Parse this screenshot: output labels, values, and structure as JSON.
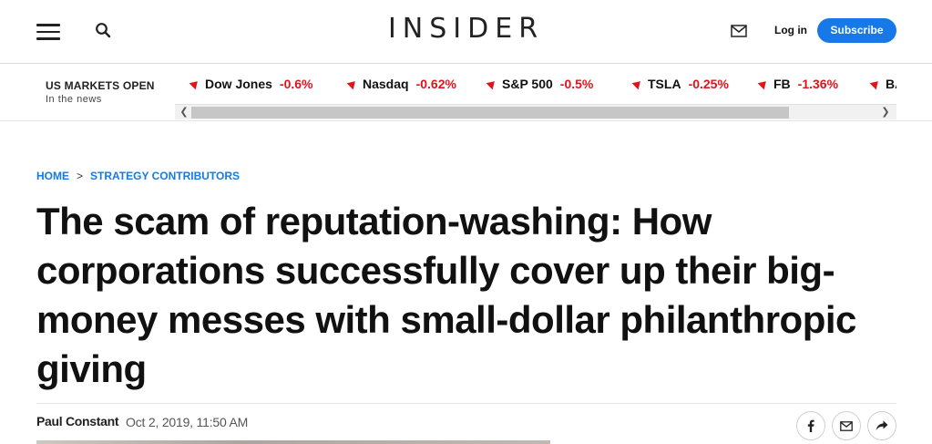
{
  "header": {
    "logo": "INSIDER",
    "login_label": "Log in",
    "subscribe_label": "Subscribe",
    "icons": [
      "hamburger-menu-icon",
      "search-icon",
      "mail-icon"
    ]
  },
  "markets": {
    "status": "US MARKETS OPEN",
    "subtitle": "In the news",
    "tickers": [
      {
        "name": "Dow Jones",
        "change": "-0.6%"
      },
      {
        "name": "Nasdaq",
        "change": "-0.62%"
      },
      {
        "name": "S&P 500",
        "change": "-0.5%"
      },
      {
        "name": "TSLA",
        "change": "-0.25%"
      },
      {
        "name": "FB",
        "change": "-1.36%"
      },
      {
        "name": "BA",
        "change": ""
      }
    ],
    "down_color": "#e0131b"
  },
  "article": {
    "breadcrumb": {
      "home": "HOME",
      "separator": ">",
      "section": "STRATEGY CONTRIBUTORS"
    },
    "headline": "The scam of reputation-washing: How corporations successfully cover up their big-money messes with small-dollar philanthropic giving",
    "author": "Paul Constant",
    "date": "Oct 2, 2019, 11:50 AM",
    "share_icons": [
      "facebook-icon",
      "mail-icon",
      "share-arrow-icon"
    ]
  },
  "colors": {
    "accent": "#1779e8",
    "text": "#111111"
  }
}
